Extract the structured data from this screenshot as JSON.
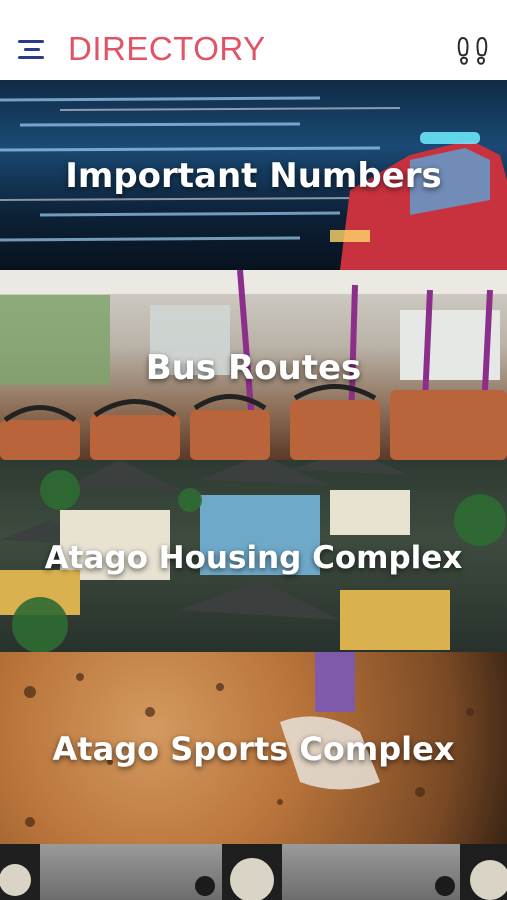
{
  "header": {
    "title": "DIRECTORY",
    "menu_icon": "hamburger-menu-icon",
    "right_icon": "footsteps-icon",
    "title_color": "#e15466",
    "icon_color": "#2a3a8c"
  },
  "tiles": [
    {
      "label": "Important Numbers"
    },
    {
      "label": "Bus Routes"
    },
    {
      "label": "Atago Housing Complex"
    },
    {
      "label": "Atago Sports Complex"
    },
    {
      "label": ""
    }
  ]
}
